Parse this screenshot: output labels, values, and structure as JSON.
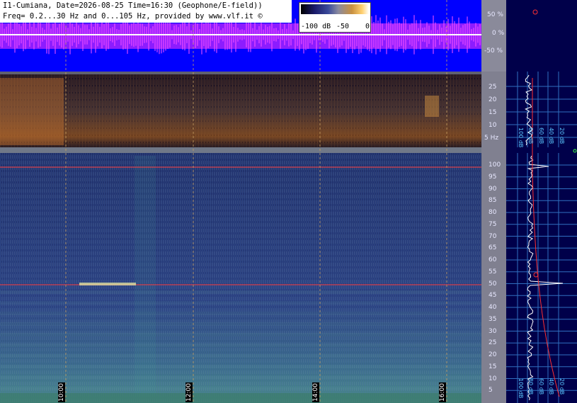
{
  "header": {
    "line1": "I1-Cumiana, Date=2026-08-25 Time=16:30 (Geophone/E-field))",
    "line2": "Freq= 0.2...30 Hz and 0...105 Hz, provided by www.vlf.it ©"
  },
  "colorbar": {
    "label_min": "-100 dB",
    "label_mid": "-50",
    "label_max": "0"
  },
  "waveform_axis": {
    "labels": [
      "50 %",
      "0 %",
      "-50 %"
    ]
  },
  "low_freq_axis": {
    "labels": [
      "25",
      "20",
      "15",
      "10",
      "5 Hz"
    ]
  },
  "high_freq_axis": {
    "labels": [
      "100",
      "95",
      "90",
      "85",
      "80",
      "75",
      "70",
      "65",
      "60",
      "55",
      "50",
      "45",
      "40",
      "35",
      "30",
      "25",
      "20",
      "15",
      "10",
      "5"
    ]
  },
  "spectrum_axis_top": {
    "labels": [
      "100 dB",
      "80 dB",
      "60 dB",
      "40 dB",
      "20 dB"
    ]
  },
  "spectrum_axis_bottom": {
    "labels": [
      "100 dB",
      "80 dB",
      "60 dB",
      "40 dB",
      "20 dB"
    ]
  },
  "time_markers": [
    "10:00",
    "12:00",
    "14:00",
    "16:00"
  ],
  "colors": {
    "waveform_bg": "#0000ff",
    "waveform_trace": "#ff33ff",
    "panel_bg": "#00004a",
    "grid_dash": "#c8a060",
    "line_50hz": "#ff4040",
    "accent_cyan": "#40a0ff"
  }
}
